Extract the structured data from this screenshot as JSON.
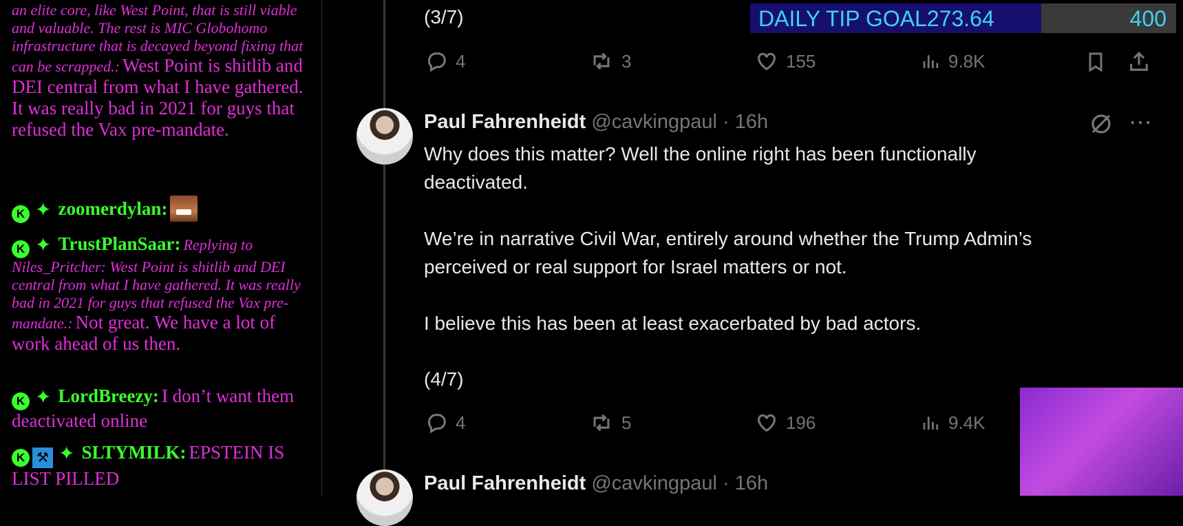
{
  "chat": {
    "msg1_italic": "an elite core, like West Point, that is still viable and valuable. The rest is MIC Globohomo infrastructure that is decayed beyond fixing that can be scrapped.:",
    "msg1_text": "West Point is shitlib and DEI central from what I have gathered. It was really bad in 2021 for guys that refused the Vax pre-mandate.",
    "msg2_user": "zoomerdylan:",
    "msg3_user": "TrustPlanSaar:",
    "msg3_italic": "Replying to Niles_Pritcher: West Point is shitlib and DEI central from what I have gathered. It was really bad in 2021 for guys that refused the Vax pre-mandate.:",
    "msg3_text": "Not great. We have a lot of work ahead of us then.",
    "msg4_user": "LordBreezy:",
    "msg4_text": "I don’t want them deactivated online",
    "msg5_user": "SLTYMILK:",
    "msg5_text": "EPSTEIN IS LIST PILLED",
    "badge_letter": "K",
    "star_glyph": "✦"
  },
  "tip_goal": {
    "label": "DAILY TIP GOAL",
    "current": "273.64",
    "goal": "400",
    "progress": 0.684
  },
  "tweet1": {
    "tail": "(3/7)",
    "replies": "4",
    "reposts": "3",
    "likes": "155",
    "views": "9.8K"
  },
  "tweet2": {
    "name": "Paul Fahrenheidt",
    "handle_time": "@cavkingpaul · 16h",
    "line1": "Why does this matter? Well the online right has been functionally",
    "line2": "deactivated.",
    "line3": "We’re in narrative Civil War, entirely around whether the Trump Admin’s",
    "line4": "perceived or real support for Israel matters or not.",
    "line5": "I believe this has been at least exacerbated by bad actors.",
    "line6": "(4/7)",
    "replies": "4",
    "reposts": "5",
    "likes": "196",
    "views": "9.4K"
  },
  "tweet3": {
    "name": "Paul Fahrenheidt",
    "handle_time": "@cavkingpaul · 16h"
  },
  "icons": [
    "reply-icon",
    "repost-icon",
    "like-icon",
    "views-icon",
    "bookmark-icon",
    "share-icon",
    "grok-icon",
    "more-icon"
  ]
}
